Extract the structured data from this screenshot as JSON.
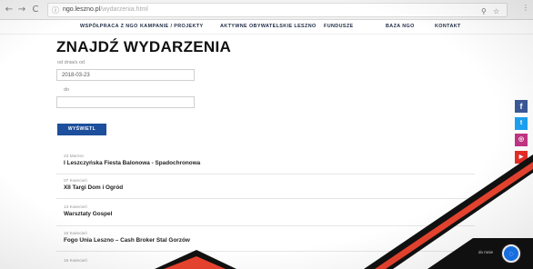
{
  "browser": {
    "url_domain": "ngo.leszno.pl",
    "url_path": "/wydarzenia.html",
    "back_glyph": "←",
    "forward_glyph": "→",
    "reload_glyph": "C",
    "info_glyph": "ⓘ",
    "zoom_glyph": "⚲",
    "star_glyph": "☆",
    "menu_glyph": "⋮"
  },
  "nav": {
    "items": [
      "WSPÓŁPRACA Z NGO",
      "KAMPANIE / PROJEKTY",
      "AKTYWNE OBYWATELSKIE LESZNO",
      "FUNDUSZE",
      "BAZA NGO",
      "KONTAKT"
    ]
  },
  "search": {
    "title": "ZNAJDŹ WYDARZENIA",
    "from_label": "od dnia/s od",
    "from_value": "2018-03-23",
    "to_label": "do",
    "to_value": "",
    "button_label": "WYŚWIETL"
  },
  "events": [
    {
      "date": "23 Marzec",
      "name": "I Leszczyńska Fiesta Balonowa - Spadochronowa"
    },
    {
      "date": "07 Kwiecień",
      "name": "XII Targi Dom i Ogród"
    },
    {
      "date": "13 Kwiecień",
      "name": "Warsztaty Gospel"
    },
    {
      "date": "15 Kwiecień",
      "name": "Fogo Unia Leszno – Cash Broker Stal Gorzów"
    },
    {
      "date": "15 Kwiecień",
      "name": ""
    }
  ],
  "social": {
    "facebook_glyph": "f",
    "twitter_glyph": "t",
    "instagram_glyph": "◎",
    "youtube_glyph": "▶"
  },
  "chat": {
    "more_label": "do mnie",
    "glyph": "◌"
  },
  "colors": {
    "accent_blue": "#1d4f9c",
    "nav_text": "#1d2a44",
    "facebook": "#3b5998",
    "twitter": "#1da1f2",
    "instagram": "#c13584",
    "youtube": "#e52d27",
    "overlay": "#e8432f"
  }
}
